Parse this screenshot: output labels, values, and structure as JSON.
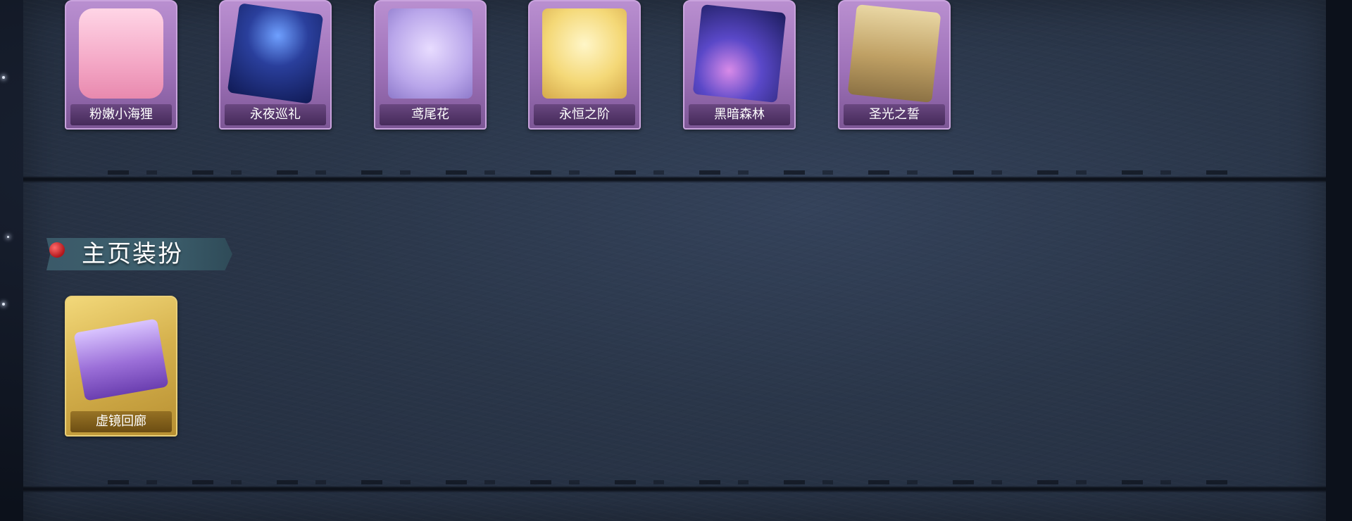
{
  "skins": {
    "items": [
      {
        "label": "粉嫩小海狸"
      },
      {
        "label": "永夜巡礼"
      },
      {
        "label": "鸢尾花"
      },
      {
        "label": "永恒之阶"
      },
      {
        "label": "黑暗森林"
      },
      {
        "label": "圣光之誓"
      }
    ]
  },
  "homepage_decor": {
    "title": "主页装扮",
    "items": [
      {
        "label": "虚镜回廊"
      }
    ]
  },
  "colors": {
    "panel": "#2a3649",
    "card_purple": "#9e71b8",
    "card_gold": "#d6b24e",
    "pin_red": "#b1161b"
  },
  "icons": [
    "pin-icon",
    "star-icon"
  ]
}
